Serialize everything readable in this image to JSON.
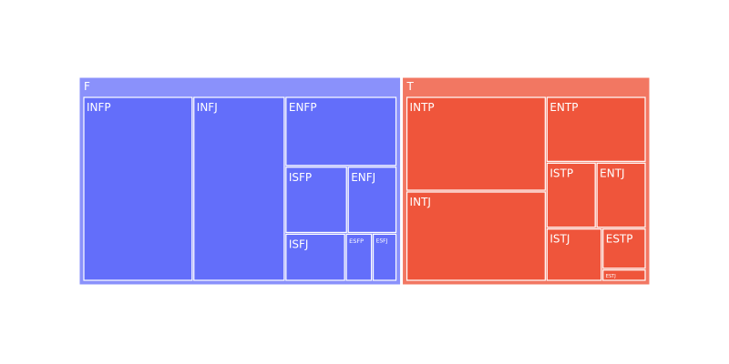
{
  "chart_data": {
    "type": "treemap",
    "title": "",
    "groups": [
      {
        "name": "F",
        "color": "#636efa",
        "parent_color": "#8a91fb",
        "items": [
          {
            "label": "INFP",
            "value": 19.0
          },
          {
            "label": "INFJ",
            "value": 15.9
          },
          {
            "label": "ENFP",
            "value": 7.3
          },
          {
            "label": "ISFP",
            "value": 3.9
          },
          {
            "label": "ENFJ",
            "value": 3.1
          },
          {
            "label": "ISFJ",
            "value": 2.7
          },
          {
            "label": "ESFP",
            "value": 1.2
          },
          {
            "label": "ESFJ",
            "value": 1.1
          }
        ]
      },
      {
        "name": "T",
        "color": "#ef553b",
        "parent_color": "#f27762",
        "items": [
          {
            "label": "INTP",
            "value": 12.5
          },
          {
            "label": "INTJ",
            "value": 11.9
          },
          {
            "label": "ENTP",
            "value": 6.2
          },
          {
            "label": "ISTP",
            "value": 3.1
          },
          {
            "label": "ENTJ",
            "value": 3.1
          },
          {
            "label": "ISTJ",
            "value": 2.8
          },
          {
            "label": "ESTP",
            "value": 1.7
          },
          {
            "label": "ESTJ",
            "value": 0.5
          }
        ]
      }
    ]
  }
}
